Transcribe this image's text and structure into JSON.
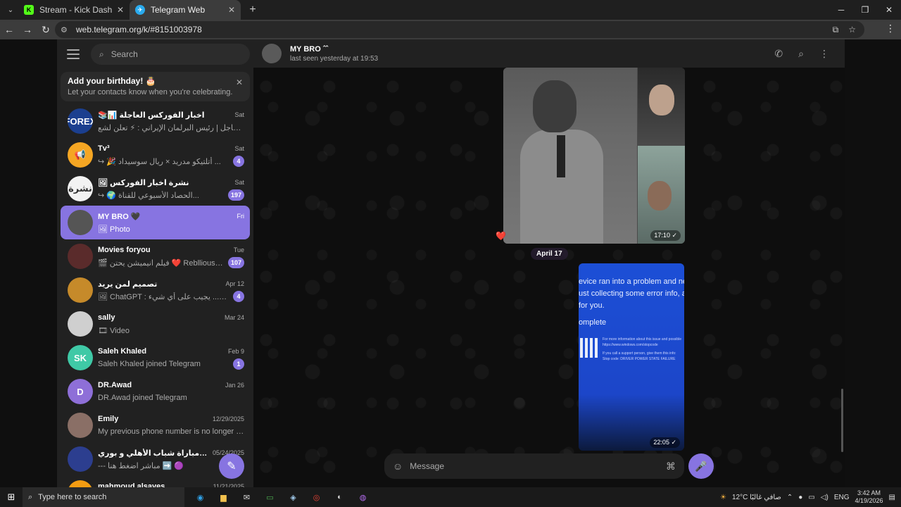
{
  "browser": {
    "tabs": [
      {
        "title": "Stream - Kick Dashboard",
        "favicon": "K",
        "favicon_color": "#53fc18"
      },
      {
        "title": "Telegram Web",
        "favicon": "✈",
        "favicon_color": "#2aabee"
      }
    ],
    "url": "web.telegram.org/k/#8151003978"
  },
  "sidebar": {
    "search_placeholder": "Search",
    "birthday": {
      "title": "Add your birthday! 🎂",
      "subtitle": "Let your contacts know when you're celebrating."
    },
    "chats": [
      {
        "name": "📚📊 اخبار الفوركس العاجلة",
        "time": "Sat",
        "preview": "عاجل | رئيس البرلمان الإيراني : ⚡ تعلن لشع...",
        "badge": "",
        "avatar_text": "FOREX",
        "avatar_color": "#1b3f8f"
      },
      {
        "name": "Tv³",
        "time": "Sat",
        "preview": "↪ 🎉 أتلتيكو مدريد × ريال سوسيداد ...",
        "badge": "4",
        "avatar_text": "📢",
        "avatar_color": "#f5a623"
      },
      {
        "name": "🖼 نشرة اخبار الفوركس",
        "time": "Sat",
        "preview": "↪ 🌍 الحصاد الأسبوعي للقناة...",
        "badge": "197",
        "avatar_text": "نشرة",
        "avatar_color": "#f2f2f2"
      },
      {
        "name": "MY BRO 🖤",
        "time": "Fri",
        "preview": "🖼 Photo",
        "badge": "",
        "avatar_text": "",
        "avatar_color": "#555555"
      },
      {
        "name": "Movies foryou",
        "time": "Tue",
        "preview": "🎬 فيلم انيميشن يحتن ❤️ Rebllious بحـ...",
        "badge": "107",
        "avatar_text": "",
        "avatar_color": "#5a2b2b"
      },
      {
        "name": "تصميم لمن يريد",
        "time": "Apr 12",
        "preview": "🖼 ChatGPT : يجيب على أي شيء ...urney",
        "badge": "4",
        "avatar_text": "",
        "avatar_color": "#c68a2a"
      },
      {
        "name": "sally",
        "time": "Mar 24",
        "preview": "🎞 Video",
        "badge": "",
        "avatar_text": "",
        "avatar_color": "#cfcfcf"
      },
      {
        "name": "Saleh Khaled",
        "time": "Feb 9",
        "preview": "Saleh Khaled joined Telegram",
        "badge": "1",
        "avatar_text": "SK",
        "avatar_color": "#3fc9a6"
      },
      {
        "name": "DR.Awad",
        "time": "Jan 26",
        "preview": "DR.Awad joined Telegram",
        "badge": "",
        "avatar_text": "D",
        "avatar_color": "#8e6fd8"
      },
      {
        "name": "Emily",
        "time": "12/29/2025",
        "preview": "My previous phone number is no longer in u...",
        "badge": "",
        "avatar_text": "",
        "avatar_color": "#8a6f66"
      },
      {
        "name": "بث مباشر مباراة شباب الأهلي و بوري...",
        "time": "05/24/2025",
        "preview": "--- مباشر اضغط هنا ➡️ 🟣",
        "badge": "",
        "avatar_text": "",
        "avatar_color": "#2c3e8f"
      },
      {
        "name": "mahmoud alsayes",
        "time": "11/21/2025",
        "preview": "",
        "badge": "",
        "avatar_text": "",
        "avatar_color": "#f39c12"
      }
    ]
  },
  "chat": {
    "title": "MY BRO ˆˆ",
    "status": "last seen yesterday at 19:53",
    "messages": [
      {
        "type": "album",
        "time": "17:10",
        "reaction": "❤️"
      },
      {
        "type": "date",
        "label": "April 17"
      },
      {
        "type": "photo",
        "time": "22:05",
        "text_lines": [
          "evice ran into a problem and ne",
          "ust collecting some error info, a",
          "for you."
        ],
        "complete": "omplete",
        "small_lines": [
          "For more information about this issue and possible",
          "https://www.windows.com/stopcode",
          "If you call a support person, give them this info:",
          "Stop code: DRIVER POWER STATE FAILURE"
        ]
      }
    ],
    "input_placeholder": "Message"
  },
  "taskbar": {
    "search_placeholder": "Type here to search",
    "weather": "12°C  صافي غالبًا",
    "lang": "ENG",
    "time": "3:42 AM",
    "date": "4/19/2026"
  },
  "colors": {
    "accent": "#8774e1",
    "sidebar_bg": "#212121",
    "chat_bg": "#0e0e0e"
  }
}
